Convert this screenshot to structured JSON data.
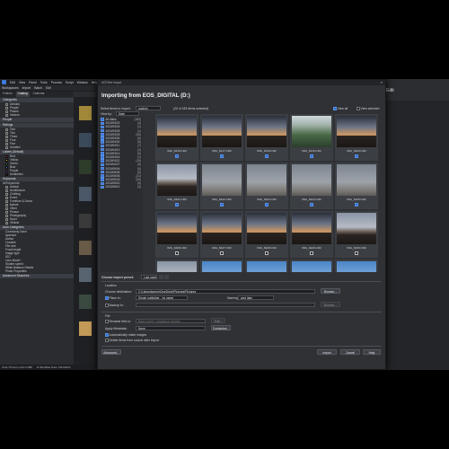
{
  "app": {
    "menu": [
      "Edit",
      "View",
      "Panel",
      "Tools",
      "Process",
      "Script",
      "Window",
      "Help"
    ],
    "toolbar": {
      "workspaces": "Workspaces",
      "import": "Import",
      "batch": "Batch",
      "edit": "Edit"
    },
    "tabs": [
      "Folders",
      "Catalog",
      "Calendar"
    ],
    "edit_label": "Edit",
    "status": "Total 78 items (212.0 MB)",
    "status_path": "D:\\Modified Date: 6/22/2023"
  },
  "left_panel": {
    "categories": {
      "title": "Categories",
      "items": [
        "Arbusto",
        "People",
        "Places",
        "Various"
      ]
    },
    "people": {
      "title": "People"
    },
    "ratings": {
      "title": "Ratings",
      "items": [
        "One",
        "Two",
        "Three",
        "Four",
        "Five",
        "Unrated"
      ]
    },
    "labels": {
      "title": "Labels (Default)",
      "items": [
        {
          "name": "Red",
          "color": "#d83a3a"
        },
        {
          "name": "Yellow",
          "color": "#e0c23a"
        },
        {
          "name": "Green",
          "color": "#3fae4a"
        },
        {
          "name": "Blue",
          "color": "#3a6fd8"
        },
        {
          "name": "Purple",
          "color": "#9a4ad8"
        },
        {
          "name": "Unlabeled",
          "color": "#1e1f21"
        }
      ]
    },
    "keywords": {
      "title": "Keywords"
    },
    "all_keywords": {
      "title": "All Keywords",
      "items": [
        "Animal",
        "Architecture",
        "Clothing",
        "Event",
        "Furniture & Decor",
        "Nature",
        "Other",
        "Person",
        "Photography",
        "Sport",
        "Vehicle"
      ]
    },
    "auto_categories": {
      "title": "Auto Categories",
      "items": [
        "Commonly Used",
        "Aperture",
        "Author",
        "Created",
        "File size",
        "Focal length",
        "Image type",
        "ISO",
        "Lens Model",
        "Shutter speed",
        "White Balance Details",
        "Photo Properties"
      ]
    },
    "advanced_searches": {
      "title": "Advanced Searches"
    }
  },
  "dialog": {
    "window_title": "ACDSee Import",
    "title": "Importing from EOS_DIGITAL (D:)",
    "select_label": "Select items to import:",
    "select_value": "custom",
    "selected_info": "(20 of 183 items selected)",
    "view_all": "View all",
    "view_selected": "View selected",
    "view_by_label": "View by:",
    "view_by_value": "Date",
    "dates": [
      {
        "label": "All dates",
        "count": "(183)"
      },
      {
        "label": "2020/03/23",
        "count": "(3)"
      },
      {
        "label": "2020/03/24",
        "count": "(1)"
      },
      {
        "label": "2020/03/25",
        "count": "(1)"
      },
      {
        "label": "2020/03/26",
        "count": "(26)"
      },
      {
        "label": "2020/03/30",
        "count": "(6)"
      },
      {
        "label": "2020/04/02",
        "count": "(5)"
      },
      {
        "label": "2020/04/11",
        "count": "(7)"
      },
      {
        "label": "2020/04/13",
        "count": "(2)"
      },
      {
        "label": "2020/04/14",
        "count": "(5)"
      },
      {
        "label": "2020/04/16",
        "count": "(1)"
      },
      {
        "label": "2020/04/21",
        "count": "(15)"
      },
      {
        "label": "2020/04/27",
        "count": "(9)"
      },
      {
        "label": "2020/05/04",
        "count": "(5)"
      },
      {
        "label": "2020/05/05",
        "count": "(5)"
      },
      {
        "label": "2020/05/06",
        "count": "(21)"
      },
      {
        "label": "2020/05/18",
        "count": "(26)"
      },
      {
        "label": "2020/05/20",
        "count": "(5)"
      },
      {
        "label": "2020/06/10",
        "count": "(3)"
      }
    ],
    "thumbnails": [
      {
        "name": "IMG_6416.CR2",
        "scene": "sunset",
        "checked": true
      },
      {
        "name": "IMG_6417.CR2",
        "scene": "sunset",
        "checked": true
      },
      {
        "name": "IMG_6418.CR2",
        "scene": "sunset",
        "checked": true
      },
      {
        "name": "IMG_6419.CR2",
        "scene": "trees",
        "checked": true
      },
      {
        "name": "IMG_6420.CR2",
        "scene": "sunset",
        "checked": true
      },
      {
        "name": "IMG_6421.CR2",
        "scene": "smoke",
        "checked": true
      },
      {
        "name": "IMG_6422.CR2",
        "scene": "haze",
        "checked": true
      },
      {
        "name": "IMG_6423.CR2",
        "scene": "haze",
        "checked": true
      },
      {
        "name": "IMG_6424.CR2",
        "scene": "haze",
        "checked": true
      },
      {
        "name": "IMG_6425.CR2",
        "scene": "haze",
        "checked": true
      },
      {
        "name": "IMG_6426.CR2",
        "scene": "sunset",
        "checked": false
      },
      {
        "name": "IMG_6427.CR2",
        "scene": "sunset",
        "checked": false
      },
      {
        "name": "IMG_6428.CR2",
        "scene": "sunset",
        "checked": false
      },
      {
        "name": "IMG_6429.CR2",
        "scene": "sunset",
        "checked": false
      },
      {
        "name": "IMG_6430.CR2",
        "scene": "smoke",
        "checked": false
      },
      {
        "name": "",
        "scene": "smoke",
        "checked": false
      },
      {
        "name": "",
        "scene": "sky",
        "checked": false
      },
      {
        "name": "",
        "scene": "sky",
        "checked": false
      },
      {
        "name": "",
        "scene": "sky",
        "checked": false
      },
      {
        "name": "",
        "scene": "sky",
        "checked": false
      }
    ],
    "preset_label": "Choose import preset:",
    "preset_value": "Last used",
    "location_label": "Location",
    "dest_label": "Choose destination:",
    "dest_value": "C:\\Users\\tommy\\OneDrive\\Pictures\\Pictures",
    "browse": "Browse...",
    "place_in_label": "Place in:",
    "place_in_value": "Single subfolder - by name",
    "naming_label": "Naming:",
    "naming_value": "wed lake",
    "backup_label": "Backup to:",
    "file_label": "File",
    "rename_label": "Rename files to:",
    "rename_value": "Base name + sequence number",
    "edit_btn": "Edit...",
    "apply_meta_label": "Apply Metadata:",
    "apply_meta_value": "None",
    "customize": "Customize...",
    "auto_rotate": "Automatically rotate images",
    "delete_after": "Delete items from source after import",
    "advanced": "Advanced...",
    "import_btn": "Import",
    "cancel_btn": "Cancel",
    "help_btn": "Help"
  },
  "side_thumbs": [
    {
      "color": "#a0873a"
    },
    {
      "color": "#3a4a5a"
    },
    {
      "color": "#2d3d2a"
    },
    {
      "color": "#4a5868"
    },
    {
      "color": "#3a3a3a"
    },
    {
      "color": "#6a5a48"
    },
    {
      "color": "#586470"
    },
    {
      "color": "#3a4a40"
    },
    {
      "color": "#c39a58"
    }
  ]
}
